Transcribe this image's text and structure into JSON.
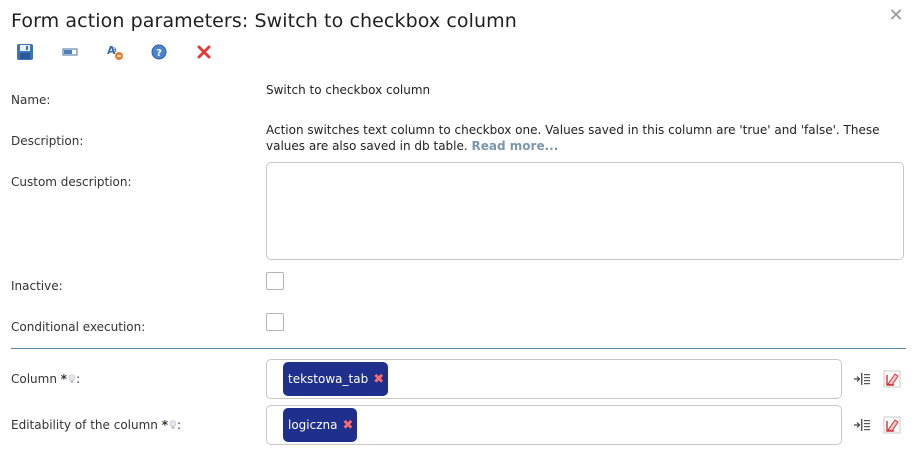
{
  "dialog": {
    "title": "Form action parameters: Switch to checkbox column",
    "close_glyph": "✕"
  },
  "toolbar": {
    "items": [
      {
        "name": "save-icon"
      },
      {
        "name": "field-icon"
      },
      {
        "name": "translate-icon"
      },
      {
        "name": "help-icon"
      },
      {
        "name": "delete-icon"
      }
    ]
  },
  "form": {
    "name_label": "Name:",
    "name_value": "Switch to checkbox column",
    "description_label": "Description:",
    "description_text": "Action switches text column to checkbox one. Values saved in this column are 'true' and 'false'. These values are also saved in db table.",
    "read_more": "Read more...",
    "custom_description_label": "Custom description:",
    "custom_description_value": "",
    "inactive_label": "Inactive:",
    "inactive_checked": false,
    "conditional_label": "Conditional execution:",
    "conditional_checked": false,
    "column_label": "Column",
    "column_required": "*",
    "column_suffix": ":",
    "column_value": "tekstowa_tab",
    "editability_label": "Editability of the column",
    "editability_required": "*",
    "editability_suffix": ":",
    "editability_value": "logiczna",
    "chip_remove_glyph": "✖"
  },
  "colors": {
    "chip_bg": "#1f2f8c",
    "chip_remove": "#ff6b6b",
    "separator": "#5e86a7",
    "link": "#7b97ad"
  }
}
